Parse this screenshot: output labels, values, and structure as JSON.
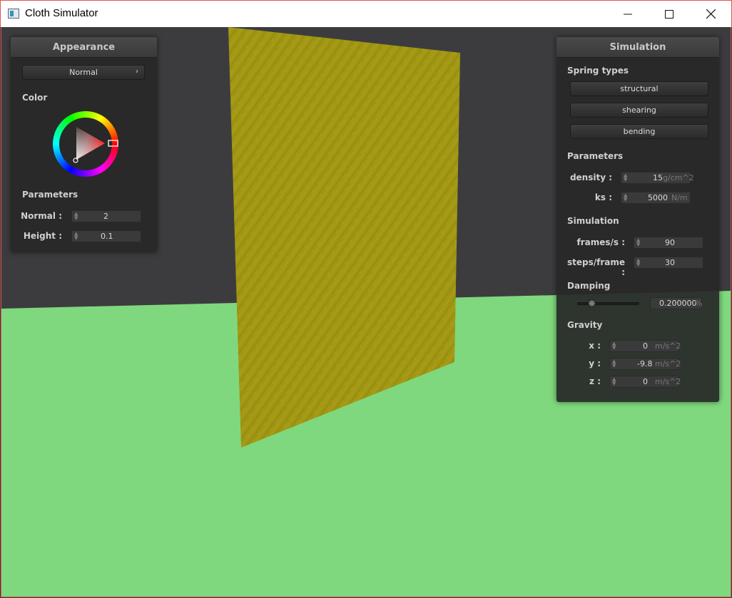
{
  "window": {
    "title": "Cloth Simulator",
    "icon": "app-window-icon",
    "controls": [
      "minimize-icon",
      "maximize-icon",
      "close-icon"
    ]
  },
  "appearance": {
    "title": "Appearance",
    "shader_select": "Normal",
    "color_label": "Color",
    "parameters_label": "Parameters",
    "normal_label": "Normal :",
    "normal_value": "2",
    "height_label": "Height :",
    "height_value": "0.1"
  },
  "simulation": {
    "title": "Simulation",
    "spring_types_label": "Spring types",
    "spring_types": [
      "structural",
      "shearing",
      "bending"
    ],
    "parameters_label": "Parameters",
    "density_label": "density :",
    "density_value": "15",
    "density_unit": "g/cm^2",
    "ks_label": "ks :",
    "ks_value": "5000",
    "ks_unit": "N/m",
    "simulation_label": "Simulation",
    "fps_label": "frames/s :",
    "fps_value": "90",
    "steps_label": "steps/frame :",
    "steps_value": "30",
    "damping_label": "Damping",
    "damping_value": "0.200000",
    "damping_unit": "%",
    "damping_slider_fraction": 0.2,
    "gravity_label": "Gravity",
    "gx_label": "x :",
    "gx_value": "0",
    "gy_label": "y :",
    "gy_value": "-9.8",
    "gz_label": "z :",
    "gz_value": "0",
    "gravity_unit": "m/s^2"
  },
  "colors": {
    "wall": "#3c3c3f",
    "floor": "#7fd87d",
    "cloth": "#a29a12",
    "panel": "#282828",
    "accent_red": "#e02a2a"
  }
}
